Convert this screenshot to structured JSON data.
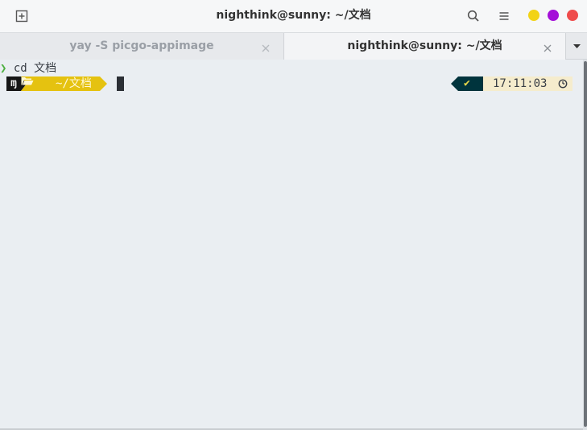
{
  "window": {
    "title": "nighthink@sunny: ~/文档",
    "controls": {
      "minimize_color": "#f2d316",
      "maximize_color": "#a40fd8",
      "close_color": "#ef4b4b"
    }
  },
  "tabs": [
    {
      "label": "yay -S picgo-appimage",
      "active": false
    },
    {
      "label": "nighthink@sunny: ~/文档",
      "active": true
    }
  ],
  "icons": {
    "new_tab": "plus-square-icon",
    "search": "search-icon",
    "menu": "hamburger-icon",
    "tab_close": "close-icon",
    "tab_menu": "caret-down-icon",
    "os": "manjaro-logo-icon",
    "folder": "folder-open-icon",
    "status": "check-icon",
    "clock": "clock-icon"
  },
  "terminal": {
    "line1": {
      "arrow": "❯",
      "command": "cd 文档"
    },
    "prompt": {
      "os_glyph": "ɱ",
      "dir": "~/文档",
      "status": "✔",
      "time": "17:11:03"
    }
  },
  "colors": {
    "dir_segment": "#e5c210",
    "status_segment": "#00343d",
    "time_segment": "#f5eccd",
    "prompt_arrow": "#4caf3f"
  }
}
